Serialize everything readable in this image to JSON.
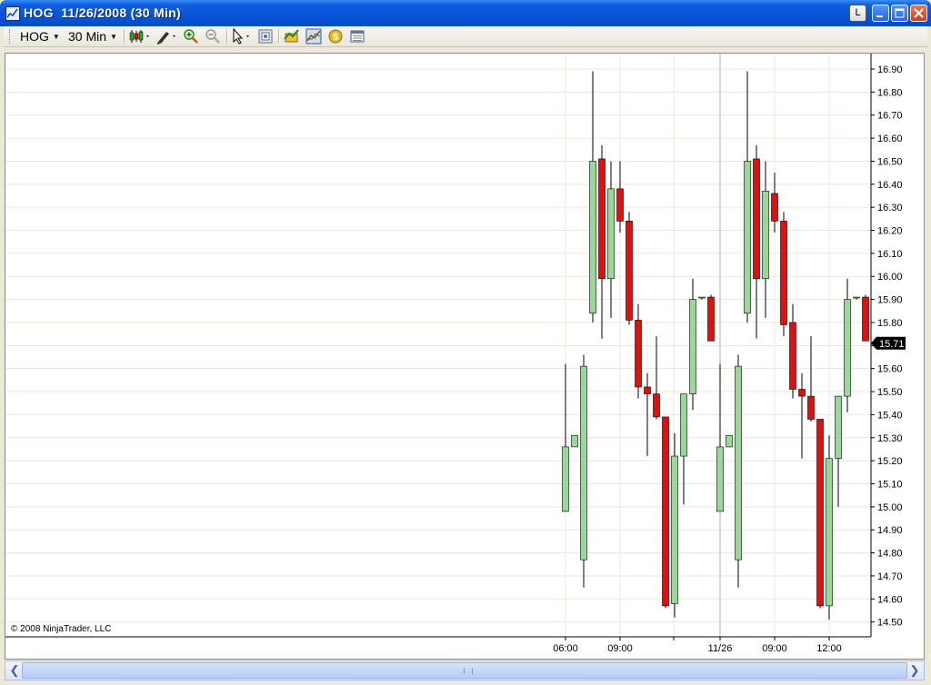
{
  "window": {
    "title": "HOG  11/26/2008 (30 Min)",
    "buttons": {
      "layout": "L",
      "minimize": "_",
      "maximize": "□",
      "close": "✕"
    }
  },
  "toolbar": {
    "instrument": "HOG",
    "interval": "30 Min",
    "icons": [
      "bar-type-candlestick-icon",
      "drawing-tool-icon",
      "zoom-in-icon",
      "zoom-out-icon",
      "pointer-icon",
      "properties-icon",
      "indicators-icon",
      "strategies-icon",
      "order-icon",
      "data-box-icon"
    ]
  },
  "copyright": "© 2008 NinjaTrader, LLC",
  "last_price": "15.71",
  "colors": {
    "up": "#9ad89a",
    "down": "#e01010",
    "grid": "#ece8d8"
  },
  "chart_data": {
    "type": "candlestick",
    "title": "HOG  11/26/2008 (30 Min)",
    "y_ticks": [
      "16.90",
      "16.80",
      "16.70",
      "16.60",
      "16.50",
      "16.40",
      "16.30",
      "16.20",
      "16.10",
      "16.00",
      "15.90",
      "15.80",
      "15.70",
      "15.60",
      "15.50",
      "15.40",
      "15.30",
      "15.20",
      "15.10",
      "15.00",
      "14.90",
      "14.80",
      "14.70",
      "14.60",
      "14.50"
    ],
    "y_range": [
      14.45,
      16.96
    ],
    "x_ticks": [
      "06:00",
      "09:00",
      "11/26",
      "09:00",
      "12:00"
    ],
    "candles": [
      {
        "o": 14.98,
        "h": 15.62,
        "l": 14.98,
        "c": 15.26
      },
      {
        "o": 15.26,
        "h": 15.31,
        "l": 15.26,
        "c": 15.31
      },
      {
        "o": 14.77,
        "h": 15.66,
        "l": 14.65,
        "c": 15.61
      },
      {
        "o": 15.84,
        "h": 16.89,
        "l": 15.8,
        "c": 16.5
      },
      {
        "o": 16.51,
        "h": 16.57,
        "l": 15.73,
        "c": 15.99
      },
      {
        "o": 15.99,
        "h": 16.5,
        "l": 15.82,
        "c": 16.38
      },
      {
        "o": 16.38,
        "h": 16.5,
        "l": 16.19,
        "c": 16.24
      },
      {
        "o": 16.24,
        "h": 16.28,
        "l": 15.79,
        "c": 15.81
      },
      {
        "o": 15.81,
        "h": 15.88,
        "l": 15.47,
        "c": 15.52
      },
      {
        "o": 15.52,
        "h": 15.58,
        "l": 15.22,
        "c": 15.49
      },
      {
        "o": 15.49,
        "h": 15.74,
        "l": 15.38,
        "c": 15.39
      },
      {
        "o": 15.39,
        "h": 15.39,
        "l": 14.56,
        "c": 14.57
      },
      {
        "o": 14.58,
        "h": 15.32,
        "l": 14.52,
        "c": 15.22
      },
      {
        "o": 15.22,
        "h": 15.49,
        "l": 15.01,
        "c": 15.49
      },
      {
        "o": 15.49,
        "h": 15.99,
        "l": 15.42,
        "c": 15.9
      },
      {
        "o": 15.91,
        "h": 15.91,
        "l": 15.9,
        "c": 15.91
      },
      {
        "o": 15.91,
        "h": 15.92,
        "l": 15.72,
        "c": 15.72
      },
      {
        "o": 14.98,
        "h": 15.62,
        "l": 14.98,
        "c": 15.26
      },
      {
        "o": 15.26,
        "h": 15.31,
        "l": 15.26,
        "c": 15.31
      },
      {
        "o": 14.77,
        "h": 15.66,
        "l": 14.65,
        "c": 15.61
      },
      {
        "o": 15.84,
        "h": 16.89,
        "l": 15.8,
        "c": 16.5
      },
      {
        "o": 16.51,
        "h": 16.57,
        "l": 15.73,
        "c": 15.99
      },
      {
        "o": 15.99,
        "h": 16.5,
        "l": 15.82,
        "c": 16.37
      },
      {
        "o": 16.36,
        "h": 16.45,
        "l": 16.19,
        "c": 16.24
      },
      {
        "o": 16.24,
        "h": 16.28,
        "l": 15.74,
        "c": 15.79
      },
      {
        "o": 15.8,
        "h": 15.88,
        "l": 15.47,
        "c": 15.51
      },
      {
        "o": 15.51,
        "h": 15.58,
        "l": 15.21,
        "c": 15.48
      },
      {
        "o": 15.48,
        "h": 15.74,
        "l": 15.37,
        "c": 15.38
      },
      {
        "o": 15.38,
        "h": 15.38,
        "l": 14.56,
        "c": 14.57
      },
      {
        "o": 14.57,
        "h": 15.31,
        "l": 14.51,
        "c": 15.21
      },
      {
        "o": 15.21,
        "h": 15.48,
        "l": 15.0,
        "c": 15.48
      },
      {
        "o": 15.48,
        "h": 15.99,
        "l": 15.41,
        "c": 15.9
      },
      {
        "o": 15.91,
        "h": 15.91,
        "l": 15.9,
        "c": 15.91
      },
      {
        "o": 15.91,
        "h": 15.92,
        "l": 15.72,
        "c": 15.72
      }
    ],
    "session_break_after": 16,
    "grid": true
  }
}
